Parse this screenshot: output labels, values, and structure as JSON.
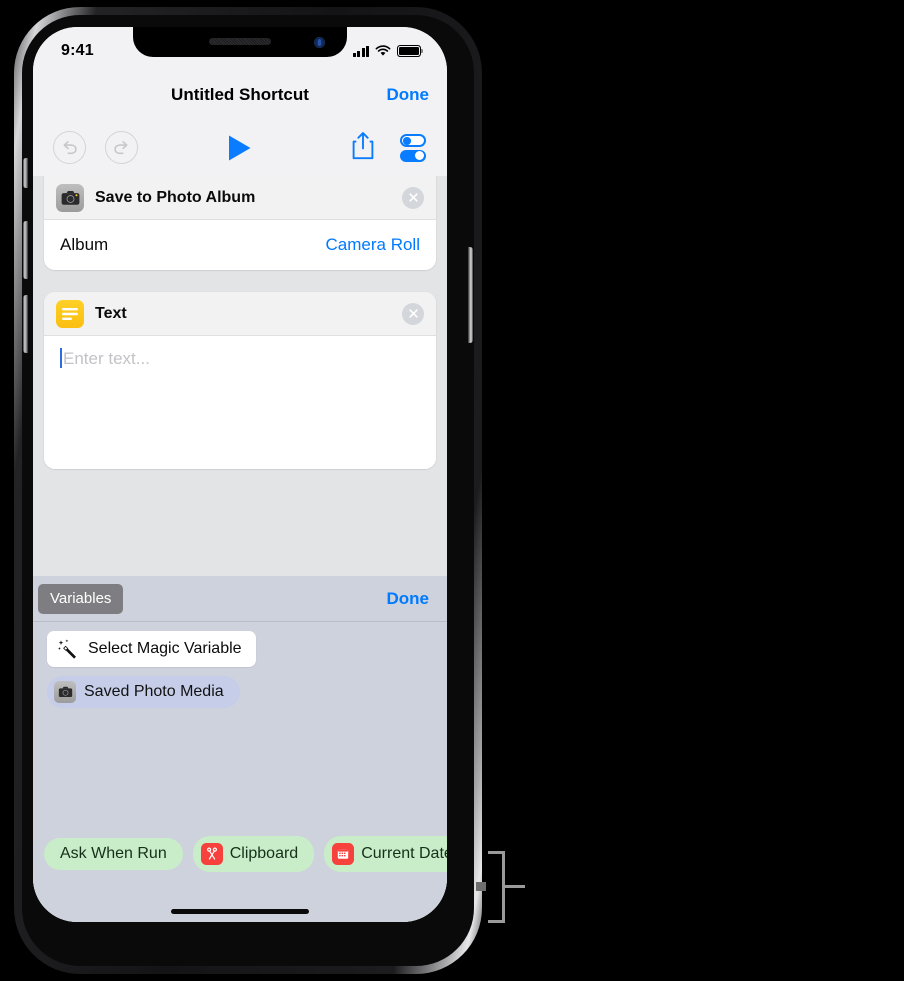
{
  "status_bar": {
    "time": "9:41",
    "icons": [
      "cellular-signal-icon",
      "wifi-icon",
      "battery-icon"
    ]
  },
  "nav_bar": {
    "title": "Untitled Shortcut",
    "done_label": "Done"
  },
  "toolbar": {
    "undo": "undo-icon",
    "redo": "redo-icon",
    "play": "play-icon",
    "share": "share-icon",
    "settings": "toggles-icon"
  },
  "actions": [
    {
      "icon": "camera-icon",
      "icon_color": "#9C9C9C",
      "title": "Save to Photo Album",
      "close": "close-icon",
      "rows": [
        {
          "label": "Album",
          "value": "Camera Roll"
        }
      ]
    },
    {
      "icon": "text-lines-icon",
      "icon_color": "#FBBE11",
      "title": "Text",
      "close": "close-icon",
      "input": {
        "value": "",
        "placeholder": "Enter text..."
      }
    }
  ],
  "variables_panel": {
    "tab_label": "Variables",
    "done_label": "Done",
    "magic_variable": {
      "icon": "magic-wand-icon",
      "label": "Select Magic Variable"
    },
    "items": [
      {
        "icon": "camera-icon",
        "label": "Saved Photo Media",
        "color": "#C5CDE8"
      }
    ],
    "bottom_chips": [
      {
        "label": "Ask When Run",
        "icon": null,
        "color": "#C9EDC8"
      },
      {
        "label": "Clipboard",
        "icon": "scissors-icon",
        "icon_color": "#F6413C",
        "color": "#C9EDC8"
      },
      {
        "label": "Current Date",
        "icon": "calendar-icon",
        "icon_color": "#F6413C",
        "color": "#C9EDC8"
      }
    ]
  },
  "colors": {
    "accent_blue": "#007AFF",
    "panel_bg": "#CED2DC",
    "scroll_bg": "#E3E4E6",
    "chip_green": "#C9EDC8",
    "chip_lavender": "#C5CDE8"
  }
}
